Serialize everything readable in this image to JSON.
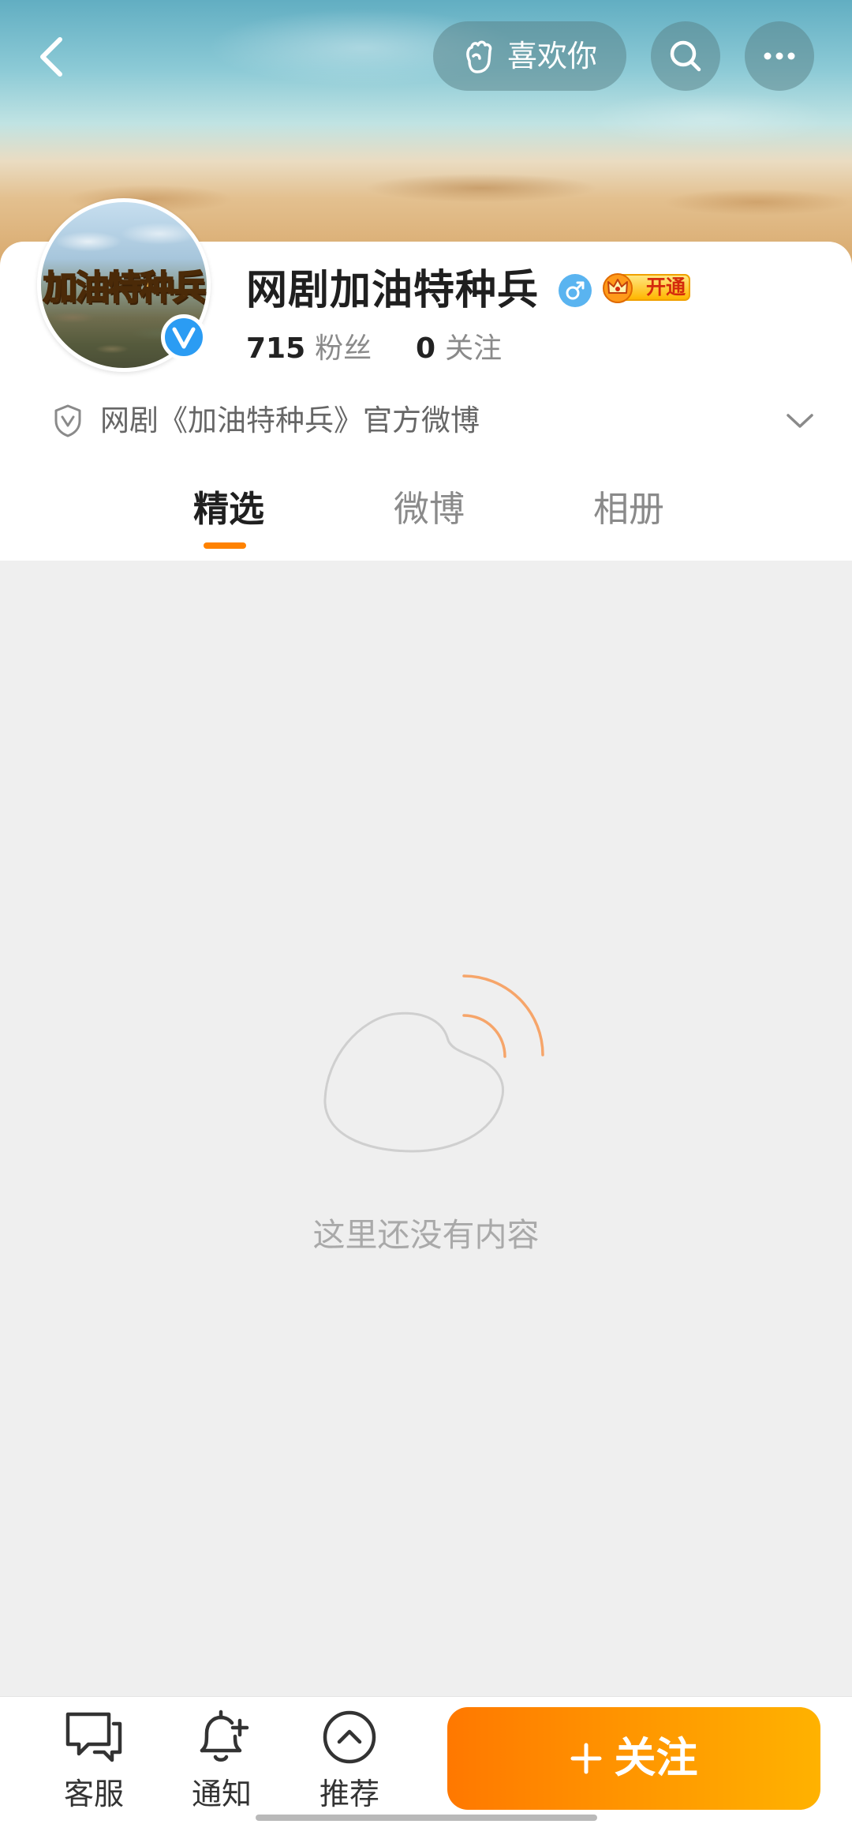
{
  "header": {
    "back_icon": "chevron-left-icon",
    "like_button": {
      "icon": "hand-heart-icon",
      "label": "喜欢你"
    },
    "search_icon": "search-icon",
    "more_icon": "more-icon"
  },
  "profile": {
    "avatar_text": "加油特种兵",
    "verified_icon": "verified-v-icon",
    "name": "网剧加油特种兵",
    "gender_icon": "male-icon",
    "vip_badge": {
      "icon": "crown-icon",
      "label": "开通"
    },
    "fans_count": "715",
    "fans_label": "粉丝",
    "following_count": "0",
    "following_label": "关注",
    "description_icon": "shield-icon",
    "description": "网剧《加油特种兵》官方微博",
    "expand_icon": "chevron-down-icon"
  },
  "tabs": [
    {
      "label": "精选",
      "active": true
    },
    {
      "label": "微博",
      "active": false
    },
    {
      "label": "相册",
      "active": false
    }
  ],
  "empty_state": {
    "illustration": "empty-cloud-icon",
    "message": "这里还没有内容"
  },
  "bottom_bar": {
    "items": [
      {
        "icon": "chat-bubbles-icon",
        "label": "客服"
      },
      {
        "icon": "bell-plus-icon",
        "label": "通知"
      },
      {
        "icon": "chevron-up-circle-icon",
        "label": "推荐"
      }
    ],
    "follow_button": {
      "icon": "plus-icon",
      "label": "关注"
    }
  },
  "colors": {
    "accent": "#ff8200",
    "accent_gradient_end": "#ffb200",
    "verified_blue": "#2b9cf3",
    "male_blue": "#5ab4f0",
    "content_background": "#efefef",
    "text_primary": "#1f1f1f",
    "text_secondary": "#8a8a8a"
  }
}
